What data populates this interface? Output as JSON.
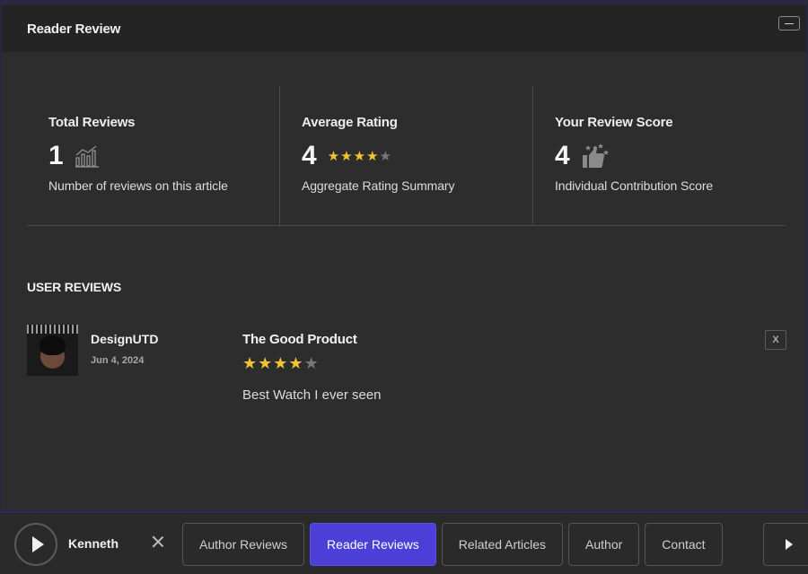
{
  "window": {
    "title": "Reader Review"
  },
  "stats": [
    {
      "title": "Total Reviews",
      "value": "1",
      "icon": "bar-chart-icon",
      "description": "Number of reviews on this article"
    },
    {
      "title": "Average Rating",
      "value": "4",
      "rating": 4,
      "max": 5,
      "description": "Aggregate Rating Summary"
    },
    {
      "title": "Your Review Score",
      "value": "4",
      "icon": "thumbs-up-stars-icon",
      "description": "Individual Contribution Score"
    }
  ],
  "reviews_section": {
    "title": "USER REVIEWS"
  },
  "review": {
    "reviewer": "DesignUTD",
    "date": "Jun 4, 2024",
    "title": "The Good Product",
    "rating": 4,
    "max": 5,
    "text": "Best Watch I ever seen",
    "close_label": "X"
  },
  "bottombar": {
    "user": "Kenneth",
    "tabs": [
      "Author Reviews",
      "Reader Reviews",
      "Related Articles",
      "Author",
      "Contact"
    ],
    "active_tab": "Reader Reviews"
  },
  "colors": {
    "accent": "#4b3fd8",
    "star": "#f4c430",
    "background": "#2d2d2d"
  }
}
